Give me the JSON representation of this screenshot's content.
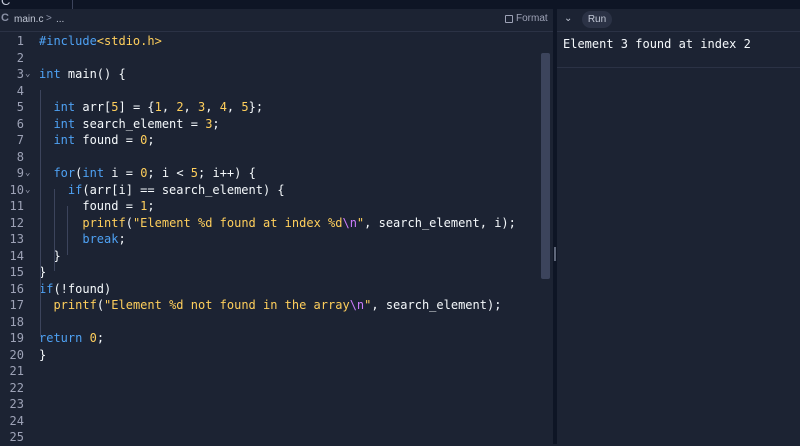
{
  "colors": {
    "background": "#1c2333",
    "keyword": "#4ea1f3",
    "literal": "#ffcf5c",
    "escape": "#cc7cfc",
    "text": "#f5f9fc",
    "line_number": "#9da2b6"
  },
  "breadcrumb": {
    "file_icon": "c-language-icon",
    "file": "main.c",
    "separator": ">",
    "more": "..."
  },
  "toolbar": {
    "format_label": "Format",
    "format_icon": "format-icon"
  },
  "console": {
    "collapse_icon": "chevron-down-icon",
    "run_label": "Run",
    "output": "Element 3 found at index 2"
  },
  "editor": {
    "lines": [
      {
        "n": "1",
        "fold": "",
        "tokens": [
          {
            "c": "pp",
            "t": "#include"
          },
          {
            "c": "inc",
            "t": "<stdio.h>"
          }
        ]
      },
      {
        "n": "2",
        "fold": "",
        "tokens": []
      },
      {
        "n": "3",
        "fold": "⌄",
        "tokens": [
          {
            "c": "kw",
            "t": "int"
          },
          {
            "c": "p",
            "t": " main() {"
          }
        ]
      },
      {
        "n": "4",
        "fold": "",
        "tokens": []
      },
      {
        "n": "5",
        "fold": "",
        "tokens": [
          {
            "c": "p",
            "t": "  "
          },
          {
            "c": "kw",
            "t": "int"
          },
          {
            "c": "p",
            "t": " arr["
          },
          {
            "c": "num",
            "t": "5"
          },
          {
            "c": "p",
            "t": "] = {"
          },
          {
            "c": "num",
            "t": "1"
          },
          {
            "c": "p",
            "t": ", "
          },
          {
            "c": "num",
            "t": "2"
          },
          {
            "c": "p",
            "t": ", "
          },
          {
            "c": "num",
            "t": "3"
          },
          {
            "c": "p",
            "t": ", "
          },
          {
            "c": "num",
            "t": "4"
          },
          {
            "c": "p",
            "t": ", "
          },
          {
            "c": "num",
            "t": "5"
          },
          {
            "c": "p",
            "t": "};"
          }
        ]
      },
      {
        "n": "6",
        "fold": "",
        "tokens": [
          {
            "c": "p",
            "t": "  "
          },
          {
            "c": "kw",
            "t": "int"
          },
          {
            "c": "p",
            "t": " search_element = "
          },
          {
            "c": "num",
            "t": "3"
          },
          {
            "c": "p",
            "t": ";"
          }
        ]
      },
      {
        "n": "7",
        "fold": "",
        "tokens": [
          {
            "c": "p",
            "t": "  "
          },
          {
            "c": "kw",
            "t": "int"
          },
          {
            "c": "p",
            "t": " found = "
          },
          {
            "c": "num",
            "t": "0"
          },
          {
            "c": "p",
            "t": ";"
          }
        ]
      },
      {
        "n": "8",
        "fold": "",
        "tokens": []
      },
      {
        "n": "9",
        "fold": "⌄",
        "tokens": [
          {
            "c": "p",
            "t": "  "
          },
          {
            "c": "kw",
            "t": "for"
          },
          {
            "c": "p",
            "t": "("
          },
          {
            "c": "kw",
            "t": "int"
          },
          {
            "c": "p",
            "t": " i = "
          },
          {
            "c": "num",
            "t": "0"
          },
          {
            "c": "p",
            "t": "; i < "
          },
          {
            "c": "num",
            "t": "5"
          },
          {
            "c": "p",
            "t": "; i++) {"
          }
        ]
      },
      {
        "n": "10",
        "fold": "⌄",
        "tokens": [
          {
            "c": "p",
            "t": "    "
          },
          {
            "c": "kw",
            "t": "if"
          },
          {
            "c": "p",
            "t": "(arr[i] == search_element) {"
          }
        ]
      },
      {
        "n": "11",
        "fold": "",
        "tokens": [
          {
            "c": "p",
            "t": "      found = "
          },
          {
            "c": "num",
            "t": "1"
          },
          {
            "c": "p",
            "t": ";"
          }
        ]
      },
      {
        "n": "12",
        "fold": "",
        "tokens": [
          {
            "c": "p",
            "t": "      "
          },
          {
            "c": "fn",
            "t": "printf"
          },
          {
            "c": "p",
            "t": "("
          },
          {
            "c": "str",
            "t": "\"Element %d found at index %d"
          },
          {
            "c": "esc",
            "t": "\\n"
          },
          {
            "c": "str",
            "t": "\""
          },
          {
            "c": "p",
            "t": ", search_element, i);"
          }
        ]
      },
      {
        "n": "13",
        "fold": "",
        "tokens": [
          {
            "c": "p",
            "t": "      "
          },
          {
            "c": "kw",
            "t": "break"
          },
          {
            "c": "p",
            "t": ";"
          }
        ]
      },
      {
        "n": "14",
        "fold": "",
        "tokens": [
          {
            "c": "p",
            "t": "  }"
          }
        ]
      },
      {
        "n": "15",
        "fold": "",
        "tokens": [
          {
            "c": "p",
            "t": "}"
          }
        ]
      },
      {
        "n": "16",
        "fold": "",
        "tokens": [
          {
            "c": "kw",
            "t": "if"
          },
          {
            "c": "p",
            "t": "(!found)"
          }
        ]
      },
      {
        "n": "17",
        "fold": "",
        "tokens": [
          {
            "c": "p",
            "t": "  "
          },
          {
            "c": "fn",
            "t": "printf"
          },
          {
            "c": "p",
            "t": "("
          },
          {
            "c": "str",
            "t": "\"Element %d not found in the array"
          },
          {
            "c": "esc",
            "t": "\\n"
          },
          {
            "c": "str",
            "t": "\""
          },
          {
            "c": "p",
            "t": ", search_element);"
          }
        ]
      },
      {
        "n": "18",
        "fold": "",
        "tokens": []
      },
      {
        "n": "19",
        "fold": "",
        "tokens": [
          {
            "c": "kw",
            "t": "return"
          },
          {
            "c": "p",
            "t": " "
          },
          {
            "c": "num",
            "t": "0"
          },
          {
            "c": "p",
            "t": ";"
          }
        ]
      },
      {
        "n": "20",
        "fold": "",
        "tokens": [
          {
            "c": "p",
            "t": "}"
          }
        ]
      },
      {
        "n": "21",
        "fold": "",
        "tokens": []
      },
      {
        "n": "22",
        "fold": "",
        "tokens": []
      },
      {
        "n": "23",
        "fold": "",
        "tokens": []
      },
      {
        "n": "24",
        "fold": "",
        "tokens": []
      },
      {
        "n": "25",
        "fold": "",
        "tokens": []
      }
    ]
  }
}
